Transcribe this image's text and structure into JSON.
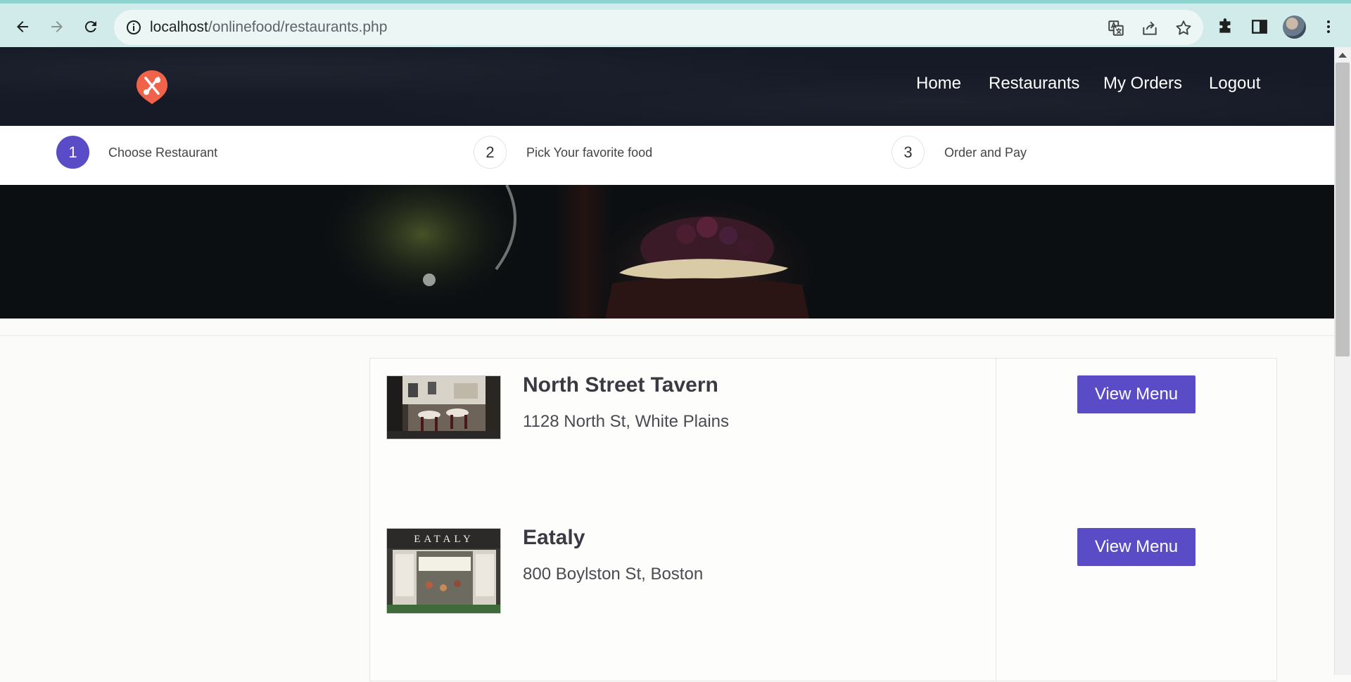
{
  "browser": {
    "url_host": "localhost",
    "url_path": "/onlinefood/restaurants.php"
  },
  "nav": {
    "items": [
      "Home",
      "Restaurants",
      "My Orders",
      "Logout"
    ]
  },
  "steps": [
    {
      "number": "1",
      "label": "Choose Restaurant",
      "active": true
    },
    {
      "number": "2",
      "label": "Pick Your favorite food",
      "active": false
    },
    {
      "number": "3",
      "label": "Order and Pay",
      "active": false
    }
  ],
  "restaurants": [
    {
      "name": "North Street Tavern",
      "address": "1128 North St, White Plains",
      "button": "View Menu"
    },
    {
      "name": "Eataly",
      "address": "800 Boylston St, Boston",
      "button": "View Menu",
      "sign_text": "EATALY"
    }
  ],
  "colors": {
    "accent": "#5a4bc6",
    "header_bg": "#151a26",
    "logo": "#f0634a"
  }
}
